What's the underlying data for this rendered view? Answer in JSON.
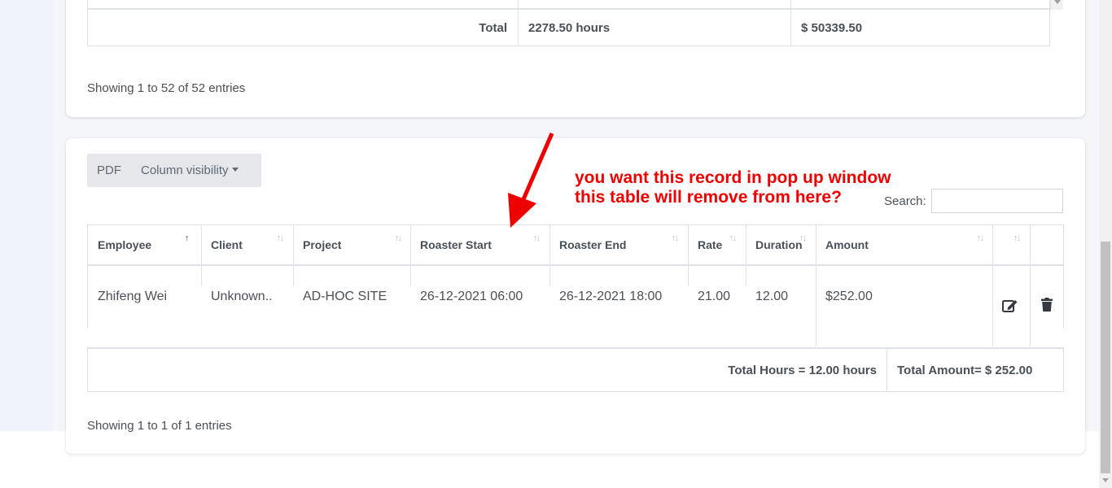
{
  "top_table": {
    "total_label": "Total",
    "total_hours": "2278.50 hours",
    "total_amount": "$ 50339.50",
    "showing": "Showing 1 to 52 of 52 entries"
  },
  "toolbar": {
    "pdf_label": "PDF",
    "column_visibility_label": "Column visibility"
  },
  "search": {
    "label": "Search:",
    "value": ""
  },
  "annotation": {
    "line1": "you want this record in pop up window",
    "line2": "this table will remove from here?",
    "color": "#ee0000"
  },
  "table": {
    "headers": [
      "Employee",
      "Client",
      "Project",
      "Roaster Start",
      "Roaster End",
      "Rate",
      "Duration",
      "Amount"
    ],
    "rows": [
      {
        "employee": "Zhifeng Wei",
        "client": "Unknown..",
        "project": "AD-HOC SITE",
        "roaster_start": "26-12-2021 06:00",
        "roaster_end": "26-12-2021 18:00",
        "rate": "21.00",
        "duration": "12.00",
        "amount": "$252.00",
        "actions": [
          "edit-icon",
          "trash-icon"
        ]
      }
    ],
    "footer": {
      "total_hours": "Total Hours = 12.00 hours",
      "total_amount": "Total Amount= $ 252.00"
    },
    "showing": "Showing 1 to 1 of 1 entries"
  }
}
